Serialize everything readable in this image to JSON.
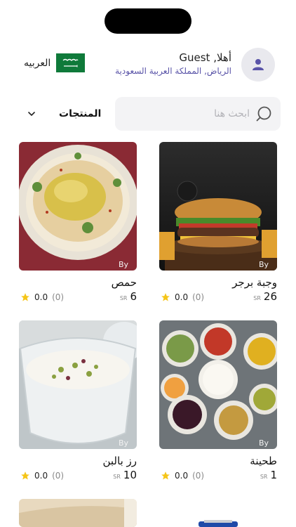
{
  "header": {
    "greeting": "أهلا, Guest",
    "location": "الرياض, المملكة العربية السعودية",
    "language": "العربيه"
  },
  "search": {
    "placeholder": "ابحث هنا"
  },
  "filter": {
    "label": "المنتجات"
  },
  "products": [
    {
      "name": "وجبة برجر",
      "price": "26",
      "currency": "SR",
      "rating": "0.0",
      "reviews": "(0)",
      "badge": "By"
    },
    {
      "name": "حمص",
      "price": "6",
      "currency": "SR",
      "rating": "0.0",
      "reviews": "(0)",
      "badge": "By"
    },
    {
      "name": "طحينة",
      "price": "1",
      "currency": "SR",
      "rating": "0.0",
      "reviews": "(0)",
      "badge": "By"
    },
    {
      "name": "رز بالبن",
      "price": "10",
      "currency": "SR",
      "rating": "0.0",
      "reviews": "(0)",
      "badge": "By"
    }
  ],
  "colors": {
    "accent": "#5a54a8",
    "star": "#f5c518",
    "flag_green": "#0f7a3a"
  }
}
